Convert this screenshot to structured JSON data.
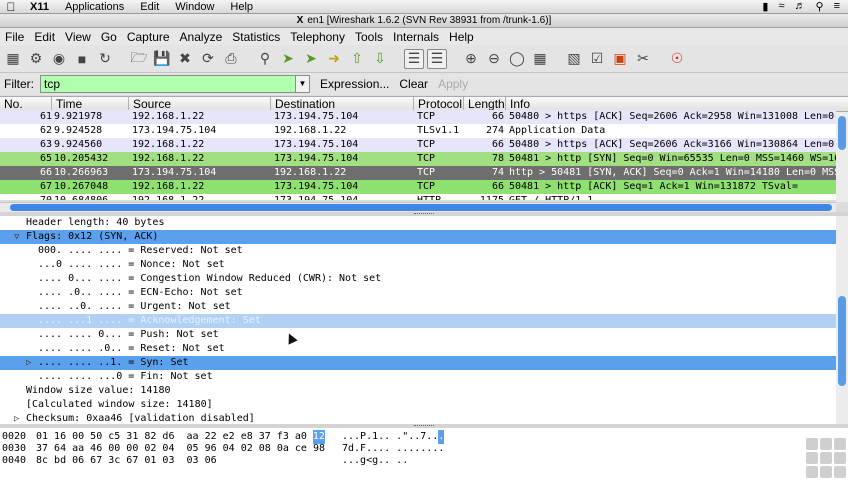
{
  "mac_menubar": {
    "app": "X11",
    "items": [
      "Applications",
      "Edit",
      "Window",
      "Help"
    ]
  },
  "window_title": "en1  [Wireshark 1.6.2  (SVN Rev 38931 from /trunk-1.6)]",
  "menubar": [
    "File",
    "Edit",
    "View",
    "Go",
    "Capture",
    "Analyze",
    "Statistics",
    "Telephony",
    "Tools",
    "Internals",
    "Help"
  ],
  "filter": {
    "label": "Filter:",
    "value": "tcp",
    "expression": "Expression...",
    "clear": "Clear",
    "apply": "Apply"
  },
  "columns": [
    "No.",
    "Time",
    "Source",
    "Destination",
    "Protocol",
    "Length",
    "Info"
  ],
  "packets": [
    {
      "no": "61",
      "time": "9.921978",
      "src": "192.168.1.22",
      "dst": "173.194.75.104",
      "proto": "TCP",
      "len": "66",
      "info": "50480 > https [ACK] Seq=2606 Ack=2958 Win=131008 Len=0",
      "style": "lav"
    },
    {
      "no": "62",
      "time": "9.924528",
      "src": "173.194.75.104",
      "dst": "192.168.1.22",
      "proto": "TLSv1.1",
      "len": "274",
      "info": "Application Data",
      "style": "white"
    },
    {
      "no": "63",
      "time": "9.924560",
      "src": "192.168.1.22",
      "dst": "173.194.75.104",
      "proto": "TCP",
      "len": "66",
      "info": "50480 > https [ACK] Seq=2606 Ack=3166 Win=130864 Len=0",
      "style": "lav"
    },
    {
      "no": "65",
      "time": "10.205432",
      "src": "192.168.1.22",
      "dst": "173.194.75.104",
      "proto": "TCP",
      "len": "78",
      "info": "50481 > http [SYN] Seq=0 Win=65535 Len=0 MSS=1460 WS=16",
      "style": "grn"
    },
    {
      "no": "66",
      "time": "10.266963",
      "src": "173.194.75.104",
      "dst": "192.168.1.22",
      "proto": "TCP",
      "len": "74",
      "info": "http > 50481 [SYN, ACK] Seq=0 Ack=1 Win=14180 Len=0 MSS",
      "style": "sel"
    },
    {
      "no": "67",
      "time": "10.267048",
      "src": "192.168.1.22",
      "dst": "173.194.75.104",
      "proto": "TCP",
      "len": "66",
      "info": "50481 > http [ACK] Seq=1 Ack=1 Win=131872 TSval=",
      "style": "grn2"
    },
    {
      "no": "70",
      "time": "10.684806",
      "src": "192.168.1.22",
      "dst": "173.194.75.104",
      "proto": "HTTP",
      "len": "1175",
      "info": "GET / HTTP/1.1",
      "style": "white"
    }
  ],
  "details": [
    {
      "text": "Header length: 40 bytes",
      "indent": 1,
      "expander": "",
      "style": ""
    },
    {
      "text": "Flags: 0x12 (SYN, ACK)",
      "indent": 1,
      "expander": "open",
      "style": "hl"
    },
    {
      "text": "000. .... .... = Reserved: Not set",
      "indent": 2,
      "expander": "",
      "style": ""
    },
    {
      "text": "...0 .... .... = Nonce: Not set",
      "indent": 2,
      "expander": "",
      "style": ""
    },
    {
      "text": ".... 0... .... = Congestion Window Reduced (CWR): Not set",
      "indent": 2,
      "expander": "",
      "style": ""
    },
    {
      "text": ".... .0.. .... = ECN-Echo: Not set",
      "indent": 2,
      "expander": "",
      "style": ""
    },
    {
      "text": ".... ..0. .... = Urgent: Not set",
      "indent": 2,
      "expander": "",
      "style": ""
    },
    {
      "text": ".... ...1 .... = Acknowledgement: Set",
      "indent": 2,
      "expander": "",
      "style": "dimhl"
    },
    {
      "text": ".... .... 0... = Push: Not set",
      "indent": 2,
      "expander": "",
      "style": ""
    },
    {
      "text": ".... .... .0.. = Reset: Not set",
      "indent": 2,
      "expander": "",
      "style": ""
    },
    {
      "text": ".... .... ..1. = Syn: Set",
      "indent": 2,
      "expander": "closed",
      "style": "hl"
    },
    {
      "text": ".... .... ...0 = Fin: Not set",
      "indent": 2,
      "expander": "",
      "style": ""
    },
    {
      "text": "Window size value: 14180",
      "indent": 1,
      "expander": "",
      "style": ""
    },
    {
      "text": "[Calculated window size: 14180]",
      "indent": 1,
      "expander": "",
      "style": ""
    },
    {
      "text": "Checksum: 0xaa46 [validation disabled]",
      "indent": 1,
      "expander": "closed",
      "style": ""
    }
  ],
  "hex": [
    {
      "offset": "0020",
      "bytes_pre": "01 16 00 50 c5 31 82 d6  aa 22 e2 e8 37 f3 a0 ",
      "bytes_hl": "12",
      "ascii_pre": "...P.1.. .\"..7..",
      "ascii_hl": "."
    },
    {
      "offset": "0030",
      "bytes_pre": "37 64 aa 46 00 00 02 04  05 96 04 02 08 0a ce 98",
      "bytes_hl": "",
      "ascii_pre": "7d.F.... ........",
      "ascii_hl": ""
    },
    {
      "offset": "0040",
      "bytes_pre": "8c bd 06 67 3c 67 01 03  03 06",
      "bytes_hl": "",
      "ascii_pre": "...g<g.. ..",
      "ascii_hl": ""
    }
  ]
}
